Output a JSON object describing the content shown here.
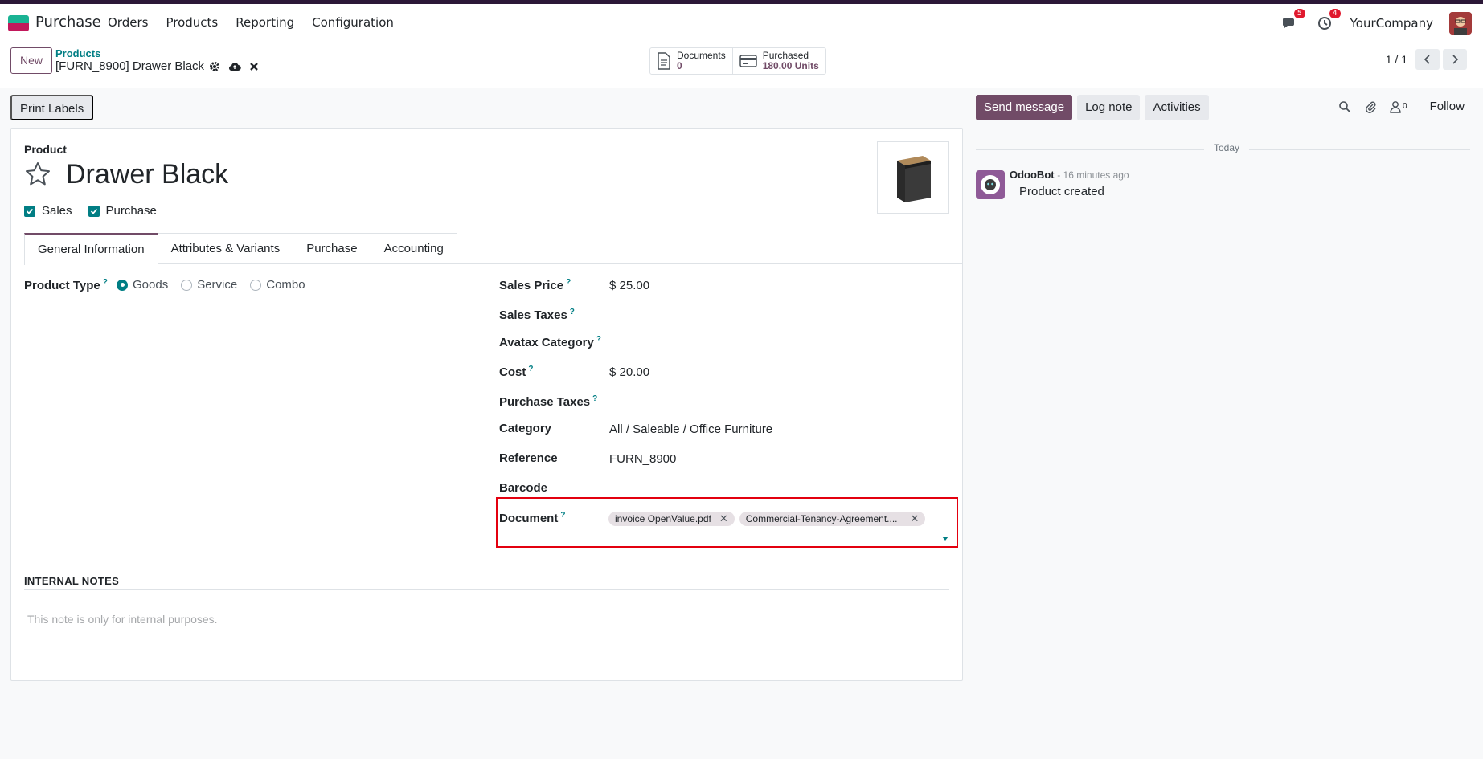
{
  "navbar": {
    "app_name": "Purchase",
    "menu": [
      "Orders",
      "Products",
      "Reporting",
      "Configuration"
    ],
    "messages_badge": "5",
    "activities_badge": "4",
    "company": "YourCompany"
  },
  "control_panel": {
    "new_label": "New",
    "breadcrumb": "Products",
    "record_title": "[FURN_8900] Drawer Black",
    "smart_buttons": [
      {
        "label": "Documents",
        "value": "0"
      },
      {
        "label": "Purchased",
        "value": "180.00 Units"
      }
    ],
    "pager": "1 / 1"
  },
  "actions": {
    "print_labels": "Print Labels"
  },
  "form": {
    "product_label": "Product",
    "product_name": "Drawer Black",
    "sales_check": "Sales",
    "purchase_check": "Purchase",
    "tabs": [
      "General Information",
      "Attributes & Variants",
      "Purchase",
      "Accounting"
    ],
    "product_type_label": "Product Type",
    "product_type_options": [
      "Goods",
      "Service",
      "Combo"
    ],
    "selected_product_type": "Goods",
    "sales_price_label": "Sales Price",
    "sales_price": "$ 25.00",
    "sales_taxes_label": "Sales Taxes",
    "avatax_label": "Avatax Category",
    "cost_label": "Cost",
    "cost": "$ 20.00",
    "purchase_taxes_label": "Purchase Taxes",
    "category_label": "Category",
    "category": "All / Saleable / Office Furniture",
    "reference_label": "Reference",
    "reference": "FURN_8900",
    "barcode_label": "Barcode",
    "document_label": "Document",
    "documents": [
      "invoice OpenValue.pdf",
      "Commercial-Tenancy-Agreement...."
    ],
    "help_mark": "?",
    "internal_notes_title": "INTERNAL NOTES",
    "internal_notes_placeholder": "This note is only for internal purposes."
  },
  "chatter": {
    "send_message": "Send message",
    "log_note": "Log note",
    "activities": "Activities",
    "followers_count": "0",
    "follow": "Follow",
    "today": "Today",
    "author": "OdooBot",
    "time": "- 16 minutes ago",
    "body": "Product created"
  },
  "colors": {
    "brand": "#714b67",
    "accent": "#017e84",
    "highlight": "#e3000f"
  }
}
